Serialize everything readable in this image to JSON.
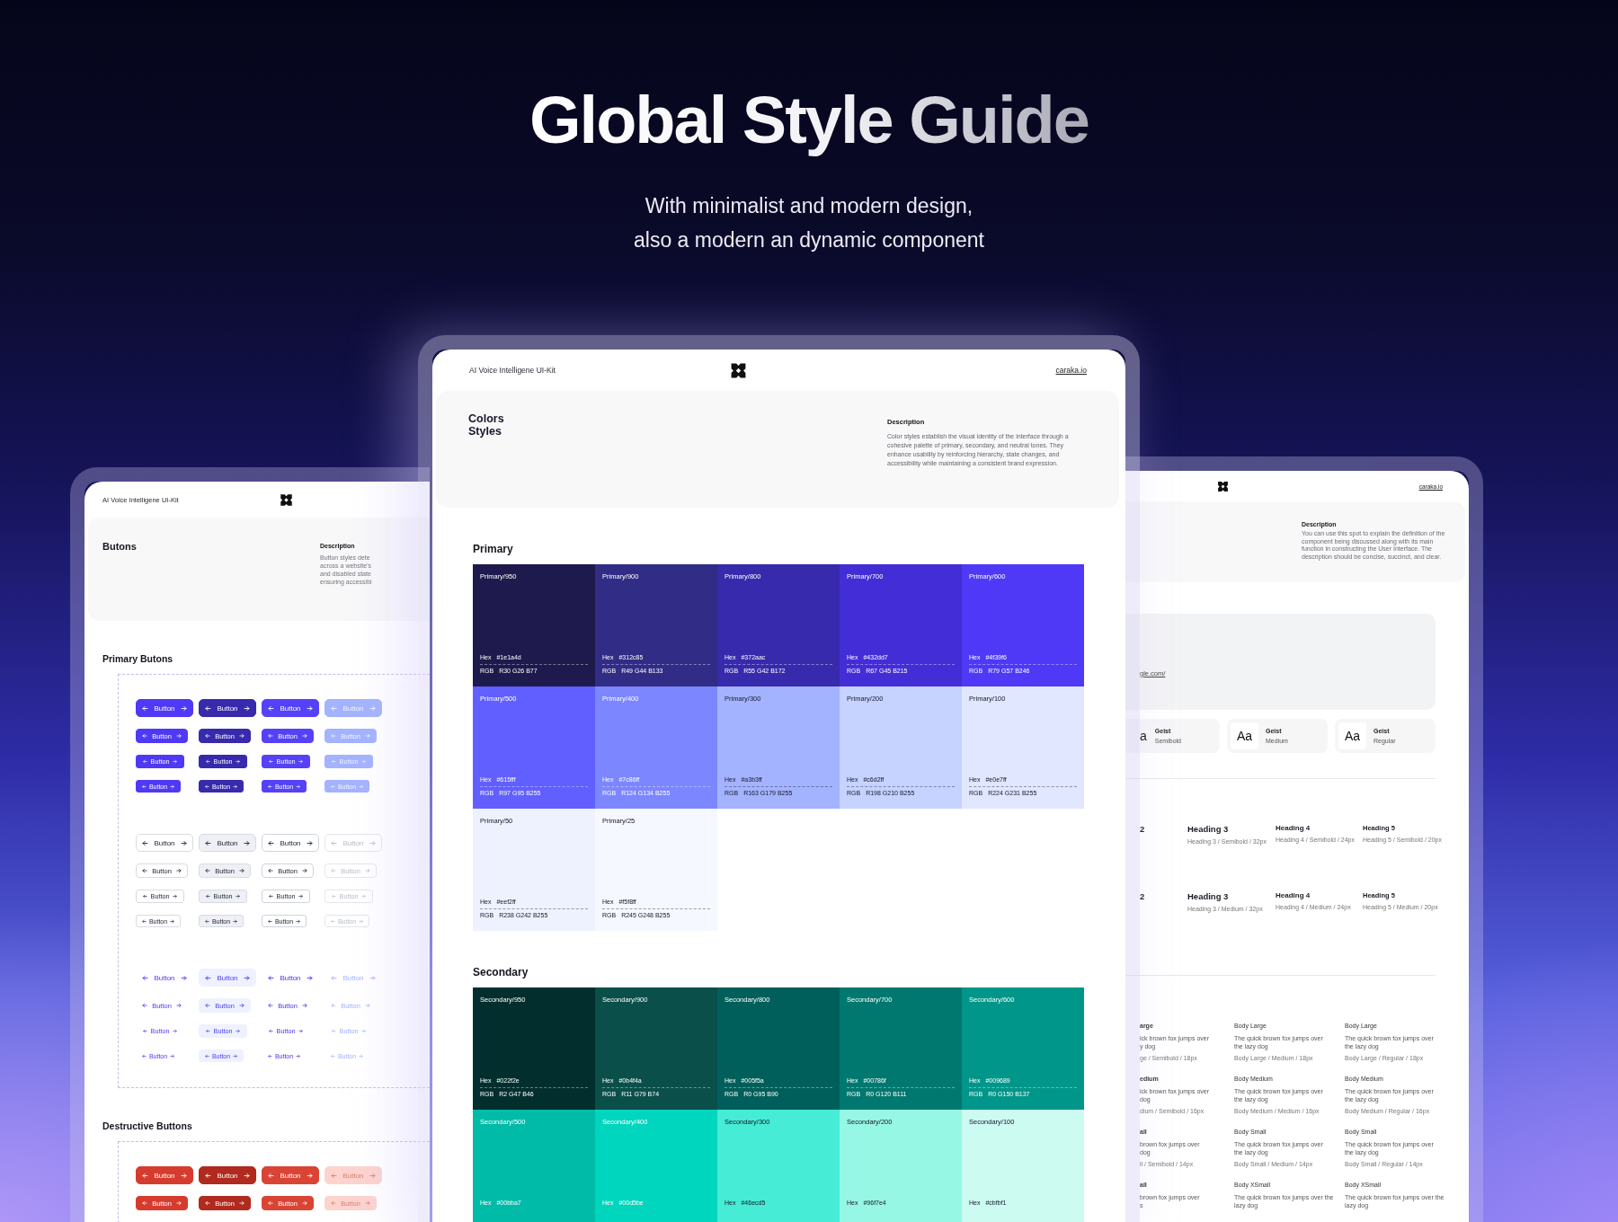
{
  "title": "Global Style Guide",
  "subtitle": [
    "With minimalist and modern design,",
    "also a modern an dynamic component"
  ],
  "left": {
    "kit": "AI Voice Intelligene UI-Kit",
    "heading": "Butons",
    "description_label": "Description",
    "description_lines": [
      "Button styles dete",
      "across a website's",
      "and disabled state",
      "ensuring accessibi"
    ],
    "sections": [
      {
        "title": "Primary Butons",
        "groups": [
          {
            "kind": "filled",
            "rows": [
              {
                "kind": "lg",
                "buttons": [
                  {
                    "label": "Button",
                    "kind": "default"
                  },
                  {
                    "label": "Button",
                    "kind": "pressed"
                  },
                  {
                    "label": "Button",
                    "kind": "hover"
                  },
                  {
                    "label": "Button",
                    "kind": "disabled"
                  }
                ]
              },
              {
                "kind": "md",
                "buttons": [
                  {
                    "label": "Button",
                    "kind": "default"
                  },
                  {
                    "label": "Button",
                    "kind": "pressed"
                  },
                  {
                    "label": "Button",
                    "kind": "hover"
                  },
                  {
                    "label": "Button",
                    "kind": "disabled"
                  }
                ]
              },
              {
                "kind": "sm",
                "buttons": [
                  {
                    "label": "Button",
                    "kind": "default"
                  },
                  {
                    "label": "Button",
                    "kind": "pressed"
                  },
                  {
                    "label": "Button",
                    "kind": "hover"
                  },
                  {
                    "label": "Button",
                    "kind": "disabled"
                  }
                ]
              },
              {
                "kind": "xs",
                "buttons": [
                  {
                    "label": "Button",
                    "kind": "default"
                  },
                  {
                    "label": "Button",
                    "kind": "pressed"
                  },
                  {
                    "label": "Button",
                    "kind": "hover"
                  },
                  {
                    "label": "Button",
                    "kind": "disabled"
                  }
                ]
              }
            ]
          },
          {
            "kind": "outline",
            "rows": [
              {
                "kind": "lg",
                "buttons": [
                  {
                    "label": "Button",
                    "kind": "default"
                  },
                  {
                    "label": "Button",
                    "kind": "pressed"
                  },
                  {
                    "label": "Button",
                    "kind": "hover"
                  },
                  {
                    "label": "Button",
                    "kind": "disabled"
                  }
                ]
              },
              {
                "kind": "md",
                "buttons": [
                  {
                    "label": "Button",
                    "kind": "default"
                  },
                  {
                    "label": "Button",
                    "kind": "pressed"
                  },
                  {
                    "label": "Button",
                    "kind": "hover"
                  },
                  {
                    "label": "Button",
                    "kind": "disabled"
                  }
                ]
              },
              {
                "kind": "sm",
                "buttons": [
                  {
                    "label": "Button",
                    "kind": "default"
                  },
                  {
                    "label": "Button",
                    "kind": "pressed"
                  },
                  {
                    "label": "Button",
                    "kind": "hover"
                  },
                  {
                    "label": "Button",
                    "kind": "disabled"
                  }
                ]
              },
              {
                "kind": "xs",
                "buttons": [
                  {
                    "label": "Button",
                    "kind": "default"
                  },
                  {
                    "label": "Button",
                    "kind": "pressed"
                  },
                  {
                    "label": "Button",
                    "kind": "hover"
                  },
                  {
                    "label": "Button",
                    "kind": "disabled"
                  }
                ]
              }
            ]
          },
          {
            "kind": "ghost",
            "rows": [
              {
                "kind": "lg",
                "buttons": [
                  {
                    "label": "Button",
                    "kind": "default"
                  },
                  {
                    "label": "Button",
                    "kind": "pressed"
                  },
                  {
                    "label": "Button",
                    "kind": "hover"
                  },
                  {
                    "label": "Button",
                    "kind": "disabled"
                  }
                ]
              },
              {
                "kind": "md",
                "buttons": [
                  {
                    "label": "Button",
                    "kind": "default"
                  },
                  {
                    "label": "Button",
                    "kind": "pressed"
                  },
                  {
                    "label": "Button",
                    "kind": "hover"
                  },
                  {
                    "label": "Button",
                    "kind": "disabled"
                  }
                ]
              },
              {
                "kind": "sm",
                "buttons": [
                  {
                    "label": "Button",
                    "kind": "default"
                  },
                  {
                    "label": "Button",
                    "kind": "pressed"
                  },
                  {
                    "label": "Button",
                    "kind": "hover"
                  },
                  {
                    "label": "Button",
                    "kind": "disabled"
                  }
                ]
              },
              {
                "kind": "xs",
                "buttons": [
                  {
                    "label": "Button",
                    "kind": "default"
                  },
                  {
                    "label": "Button",
                    "kind": "pressed"
                  },
                  {
                    "label": "Button",
                    "kind": "hover"
                  },
                  {
                    "label": "Button",
                    "kind": "disabled"
                  }
                ]
              }
            ]
          }
        ]
      },
      {
        "title": "Destructive Buttons",
        "groups": [
          {
            "kind": "destructive",
            "rows": [
              {
                "kind": "lg",
                "buttons": [
                  {
                    "label": "Button",
                    "kind": "default"
                  },
                  {
                    "label": "Button",
                    "kind": "pressed"
                  },
                  {
                    "label": "Button",
                    "kind": "hover"
                  },
                  {
                    "label": "Button",
                    "kind": "disabled"
                  }
                ]
              },
              {
                "kind": "md",
                "buttons": [
                  {
                    "label": "Button",
                    "kind": "default"
                  },
                  {
                    "label": "Button",
                    "kind": "pressed"
                  },
                  {
                    "label": "Button",
                    "kind": "hover"
                  },
                  {
                    "label": "Button",
                    "kind": "disabled"
                  }
                ]
              }
            ]
          }
        ]
      }
    ]
  },
  "center": {
    "kit": "AI Voice Intelligene UI-Kit",
    "link": "caraka.io",
    "heading": "Colors Styles",
    "description_label": "Description",
    "description": "Color styles establish the visual identity of the interface through a cohesive palette of primary, secondary, and neutral tones. They enhance usability by reinforcing hierarchy, state changes, and accessibility while maintaining a consistent brand expression.",
    "palettes": [
      {
        "title": "Primary",
        "swatches": [
          {
            "name": "Primary/950",
            "color": "#1e1a4d",
            "hex_label": "Hex",
            "hex": "#1e1a4d",
            "rgb_label": "RGB",
            "rgb": "R30 G26 B77"
          },
          {
            "name": "Primary/900",
            "color": "#312c85",
            "hex_label": "Hex",
            "hex": "#312c85",
            "rgb_label": "RGB",
            "rgb": "R49 G44 B133"
          },
          {
            "name": "Primary/800",
            "color": "#372aac",
            "hex_label": "Hex",
            "hex": "#372aac",
            "rgb_label": "RGB",
            "rgb": "R55 G42 B172"
          },
          {
            "name": "Primary/700",
            "color": "#432dd7",
            "hex_label": "Hex",
            "hex": "#432dd7",
            "rgb_label": "RGB",
            "rgb": "R67 G45 B215"
          },
          {
            "name": "Primary/600",
            "color": "#4f39f6",
            "hex_label": "Hex",
            "hex": "#4f39f6",
            "rgb_label": "RGB",
            "rgb": "R79 G57 B246"
          },
          {
            "name": "Primary/500",
            "color": "#615fff",
            "hex_label": "Hex",
            "hex": "#615fff",
            "rgb_label": "RGB",
            "rgb": "R97 G95 B255"
          },
          {
            "name": "Primary/400",
            "color": "#7c86ff",
            "hex_label": "Hex",
            "hex": "#7c86ff",
            "rgb_label": "RGB",
            "rgb": "R124 G134 B255"
          },
          {
            "name": "Primary/300",
            "color": "#a3b3ff",
            "hex_label": "Hex",
            "hex": "#a3b3ff",
            "rgb_label": "RGB",
            "rgb": "R163 G179 B255"
          },
          {
            "name": "Primary/200",
            "color": "#c6d2ff",
            "hex_label": "Hex",
            "hex": "#c6d2ff",
            "rgb_label": "RGB",
            "rgb": "R198 G210 B255"
          },
          {
            "name": "Primary/100",
            "color": "#e0e7ff",
            "hex_label": "Hex",
            "hex": "#e0e7ff",
            "rgb_label": "RGB",
            "rgb": "R224 G231 B255"
          },
          {
            "name": "Primary/50",
            "color": "#eef2ff",
            "hex_label": "Hex",
            "hex": "#eef2ff",
            "rgb_label": "RGB",
            "rgb": "R238 G242 B255"
          },
          {
            "name": "Primary/25",
            "color": "#f5f8ff",
            "hex_label": "Hex",
            "hex": "#f5f8ff",
            "rgb_label": "RGB",
            "rgb": "R245 G248 B255"
          }
        ]
      },
      {
        "title": "Secondary",
        "swatches": [
          {
            "name": "Secondary/950",
            "color": "#022f2e",
            "hex_label": "Hex",
            "hex": "#022f2e",
            "rgb_label": "RGB",
            "rgb": "R2 G47 B46"
          },
          {
            "name": "Secondary/900",
            "color": "#0b4f4a",
            "hex_label": "Hex",
            "hex": "#0b4f4a",
            "rgb_label": "RGB",
            "rgb": "R11 G79 B74"
          },
          {
            "name": "Secondary/800",
            "color": "#005f5a",
            "hex_label": "Hex",
            "hex": "#005f5a",
            "rgb_label": "RGB",
            "rgb": "R0 G95 B90"
          },
          {
            "name": "Secondary/700",
            "color": "#00786f",
            "hex_label": "Hex",
            "hex": "#00786f",
            "rgb_label": "RGB",
            "rgb": "R0 G120 B111"
          },
          {
            "name": "Secondary/600",
            "color": "#009689",
            "hex_label": "Hex",
            "hex": "#009689",
            "rgb_label": "RGB",
            "rgb": "R0 G150 B137"
          },
          {
            "name": "Secondary/500",
            "color": "#00bba7",
            "hex_label": "Hex",
            "hex": "#00bba7"
          },
          {
            "name": "Secondary/400",
            "color": "#00d5be",
            "hex_label": "Hex",
            "hex": "#00d5be"
          },
          {
            "name": "Secondary/300",
            "color": "#46ecd5",
            "hex_label": "Hex",
            "hex": "#46ecd5"
          },
          {
            "name": "Secondary/200",
            "color": "#96f7e4",
            "hex_label": "Hex",
            "hex": "#96f7e4"
          },
          {
            "name": "Secondary/100",
            "color": "#cbfbf1",
            "hex_label": "Hex",
            "hex": "#cbfbf1"
          }
        ]
      }
    ]
  },
  "right": {
    "link": "caraka.io",
    "description_label": "Description",
    "description": "You can use this spot to explain the definition of the component being discussed along with its main function in constructing the User Interface. The description should be concise, succinct, and clear.",
    "preview_link": "gle.com/",
    "fonts": [
      {
        "sample": "a",
        "name": "Geist",
        "weight": "Semibold"
      },
      {
        "sample": "Aa",
        "name": "Geist",
        "weight": "Medium"
      },
      {
        "sample": "Aa",
        "name": "Geist",
        "weight": "Regular"
      }
    ],
    "heading_rows": [
      [
        {
          "title": "2"
        },
        {
          "title": "Heading 3",
          "spec": "Heading 3 / Semibold / 32px"
        },
        {
          "title": "Heading 4",
          "spec": "Heading 4 / Semibold / 24px"
        },
        {
          "title": "Heading 5",
          "spec": "Heading 5 / Semibold / 20px"
        }
      ],
      [
        {
          "title": "2"
        },
        {
          "title": "Heading 3",
          "spec": "Heading 3 / Medium / 32px"
        },
        {
          "title": "Heading 4",
          "spec": "Heading 4 / Medium / 24px"
        },
        {
          "title": "Heading 5",
          "spec": "Heading 5 / Medium / 20px"
        }
      ]
    ],
    "body_rows": [
      [
        {
          "title": "arge",
          "lines": [
            "ick brown fox jumps over",
            "y dog"
          ],
          "spec": "ge / Semibold / 18px"
        },
        {
          "title": "Body Large",
          "lines": [
            "The quick brown fox jumps over",
            "the lazy dog"
          ],
          "spec": "Body Large / Medium / 18px"
        },
        {
          "title": "Body Large",
          "lines": [
            "The quick brown fox jumps over",
            "the lazy dog"
          ],
          "spec": "Body Large / Regular / 18px"
        }
      ],
      [
        {
          "title": "edium",
          "lines": [
            "ick brown fox jumps over",
            "dog"
          ],
          "spec": "dium / Semibold / 16px"
        },
        {
          "title": "Body Medium",
          "lines": [
            "The quick brown fox jumps over",
            "the lazy dog"
          ],
          "spec": "Body Medium / Medium / 16px"
        },
        {
          "title": "Body Medium",
          "lines": [
            "The quick brown fox jumps over",
            "the lazy dog"
          ],
          "spec": "Body Medium / Regular / 16px"
        }
      ],
      [
        {
          "title": "all",
          "lines": [
            "brown fox jumps over",
            "dog"
          ],
          "spec": "ll / Semibold / 14px"
        },
        {
          "title": "Body Small",
          "lines": [
            "The quick brown fox jumps over",
            "the lazy dog"
          ],
          "spec": "Body Small / Medium / 14px"
        },
        {
          "title": "Body Small",
          "lines": [
            "The quick brown fox jumps over",
            "the lazy dog"
          ],
          "spec": "Body Small / Regular / 14px"
        }
      ],
      [
        {
          "title": "all",
          "lines": [
            "brown fox jumps over",
            "s"
          ]
        },
        {
          "title": "Body XSmall",
          "lines": [
            "The quick brown fox jumps over the",
            "lazy dog"
          ]
        },
        {
          "title": "Body XSmall",
          "lines": [
            "The quick brown fox jumps over the",
            "lazy dog"
          ]
        }
      ]
    ]
  }
}
